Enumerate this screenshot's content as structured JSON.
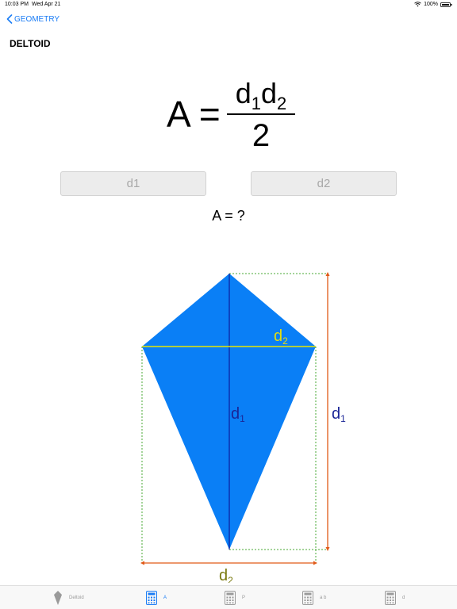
{
  "status": {
    "time": "10:03 PM",
    "date": "Wed Apr 21",
    "battery": "100%"
  },
  "nav": {
    "back_label": "GEOMETRY"
  },
  "page": {
    "title": "DELTOID"
  },
  "formula": {
    "lhs": "A =",
    "num_var1": "d",
    "num_sub1": "1",
    "num_var2": "d",
    "num_sub2": "2",
    "denominator": "2"
  },
  "inputs": {
    "d1_placeholder": "d1",
    "d2_placeholder": "d2"
  },
  "result": {
    "text": "A = ?"
  },
  "diagram": {
    "d1_label": "d",
    "d1_sub": "1",
    "d2_label": "d",
    "d2_sub": "2",
    "colors": {
      "kite_fill": "#0a7ff6",
      "diag_d1": "#0c1d9e",
      "diag_d2": "#e6e600",
      "dim_line": "#e05a18",
      "dotted_outline": "#4aa835",
      "d2_label_top": "#e3dd10",
      "d2_label_bottom": "#7a7a10",
      "d1_label": "#1a2596"
    }
  },
  "tabs": [
    {
      "label": "Deltoid",
      "icon": "kite-shape-icon",
      "active": false
    },
    {
      "label": "A",
      "icon": "calculator-icon",
      "active": true
    },
    {
      "label": "P",
      "icon": "calculator-icon",
      "active": false
    },
    {
      "label": "a b",
      "icon": "calculator-icon",
      "active": false
    },
    {
      "label": "d",
      "icon": "calculator-icon",
      "active": false
    }
  ]
}
